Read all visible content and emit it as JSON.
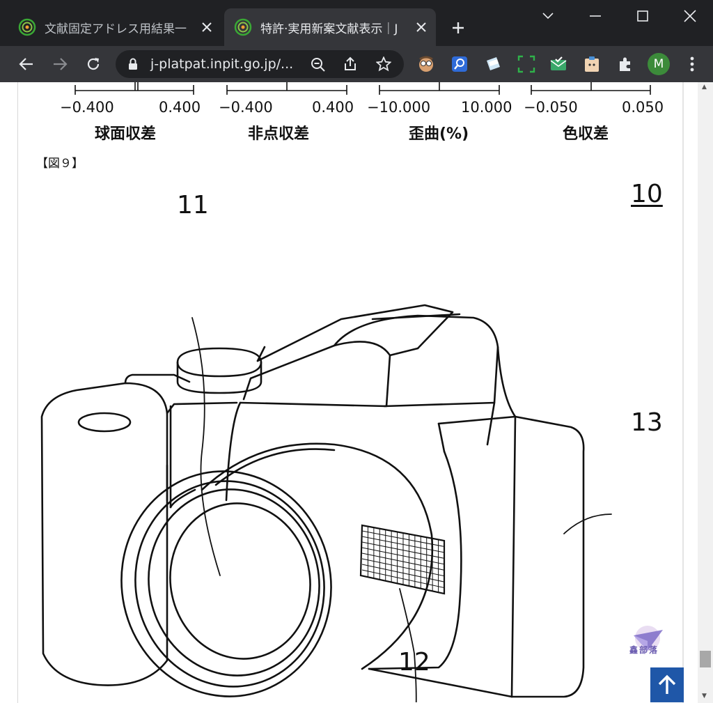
{
  "browser": {
    "tabs": [
      {
        "title": "文献固定アドレス用結果一",
        "active": false,
        "favicon": "jplatpat-spiral-icon"
      },
      {
        "title": "特許·実用新案文献表示｜J",
        "active": true,
        "favicon": "jplatpat-spiral-icon"
      }
    ],
    "url": "j-platpat.inpit.go.jp/...",
    "avatar_initial": "M",
    "extensions": [
      "face-extension-icon",
      "search-extension-icon",
      "notes-extension-icon",
      "screenshot-extension-icon",
      "mail-check-extension-icon",
      "clipboard-extension-icon",
      "puzzle-icon"
    ]
  },
  "aberration_axes": [
    {
      "min": "−0.400",
      "max": "0.400",
      "title": "球面収差"
    },
    {
      "min": "−0.400",
      "max": "0.400",
      "title": "非点収差"
    },
    {
      "min": "−10.000",
      "max": "10.000",
      "title": "歪曲(%)"
    },
    {
      "min": "−0.050",
      "max": "0.050",
      "title": "色収差"
    }
  ],
  "figure": {
    "label": "【図９】",
    "ref_numbers": {
      "camera": "10",
      "lens": "11",
      "flash": "12",
      "body": "13"
    }
  },
  "watermark_text": "鑫部落",
  "colors": {
    "tab_bg": "#202124",
    "toolbar_bg": "#35363a",
    "totop_bg": "#1f57a8",
    "avatar_bg": "#3c8b3a"
  }
}
